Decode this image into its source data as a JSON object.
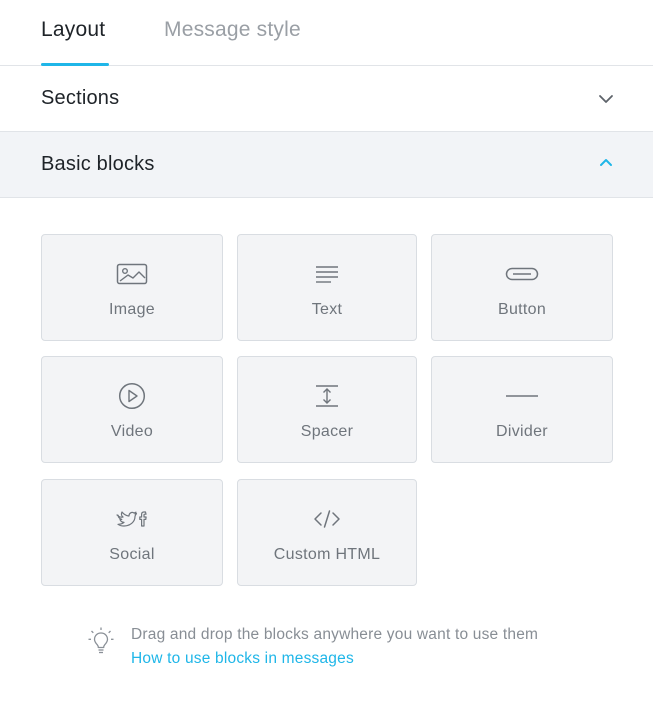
{
  "tabs": [
    {
      "label": "Layout",
      "active": true
    },
    {
      "label": "Message style",
      "active": false
    }
  ],
  "sections": {
    "title": "Sections",
    "expanded": false
  },
  "basic_blocks": {
    "title": "Basic blocks",
    "expanded": true,
    "items": [
      {
        "label": "Image",
        "icon": "image-icon"
      },
      {
        "label": "Text",
        "icon": "text-lines-icon"
      },
      {
        "label": "Button",
        "icon": "button-pill-icon"
      },
      {
        "label": "Video",
        "icon": "play-circle-icon"
      },
      {
        "label": "Spacer",
        "icon": "spacer-icon"
      },
      {
        "label": "Divider",
        "icon": "divider-line-icon"
      },
      {
        "label": "Social",
        "icon": "social-twitter-facebook-icon"
      },
      {
        "label": "Custom HTML",
        "icon": "code-brackets-icon"
      }
    ]
  },
  "hint": {
    "text": "Drag and drop the blocks anywhere you want to use them",
    "link": "How to use blocks in messages",
    "icon": "lightbulb-icon"
  },
  "colors": {
    "accent": "#1fb6e8",
    "block_bg": "#f3f4f6",
    "header_open_bg": "#f2f4f7"
  }
}
